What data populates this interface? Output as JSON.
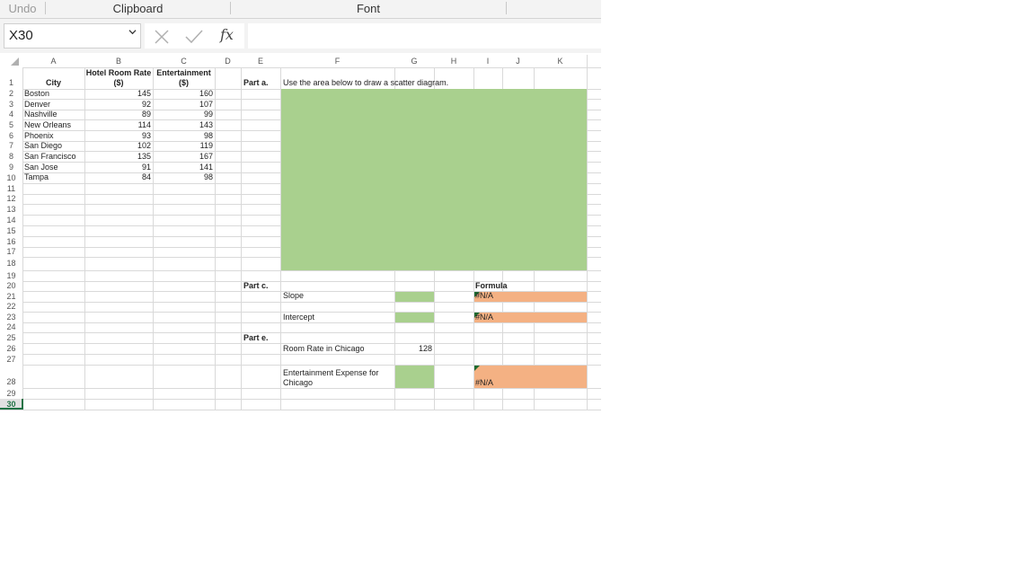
{
  "ribbon": {
    "undo": "Undo",
    "clipboard": "Clipboard",
    "font": "Font"
  },
  "formula_bar": {
    "name_box": "X30",
    "formula": ""
  },
  "columns": [
    "A",
    "B",
    "C",
    "D",
    "E",
    "F",
    "G",
    "H",
    "I",
    "J",
    "K"
  ],
  "rows": [
    "1",
    "2",
    "3",
    "4",
    "5",
    "6",
    "7",
    "8",
    "9",
    "10",
    "11",
    "12",
    "13",
    "14",
    "15",
    "16",
    "17",
    "18",
    "19",
    "20",
    "21",
    "22",
    "23",
    "24",
    "25",
    "26",
    "27",
    "28",
    "29",
    "30"
  ],
  "table": {
    "header_city": "City",
    "header_rate_1": "Hotel Room Rate",
    "header_rate_2": "($)",
    "header_ent_1": "Entertainment",
    "header_ent_2": "($)",
    "data": [
      {
        "city": "Boston",
        "rate": "145",
        "ent": "160"
      },
      {
        "city": "Denver",
        "rate": "92",
        "ent": "107"
      },
      {
        "city": "Nashville",
        "rate": "89",
        "ent": "99"
      },
      {
        "city": "New Orleans",
        "rate": "114",
        "ent": "143"
      },
      {
        "city": "Phoenix",
        "rate": "93",
        "ent": "98"
      },
      {
        "city": "San Diego",
        "rate": "102",
        "ent": "119"
      },
      {
        "city": "San Francisco",
        "rate": "135",
        "ent": "167"
      },
      {
        "city": "San Jose",
        "rate": "91",
        "ent": "141"
      },
      {
        "city": "Tampa",
        "rate": "84",
        "ent": "98"
      }
    ]
  },
  "parts": {
    "part_a": "Part a.",
    "part_a_text": "Use the area below to draw a scatter diagram.",
    "part_c": "Part c.",
    "formula_header": "Formula",
    "slope": "Slope",
    "intercept": "Intercept",
    "part_e": "Part e.",
    "room_rate_chicago": "Room Rate in Chicago",
    "room_rate_value": "128",
    "ent_expense_1": "Entertainment Expense for",
    "ent_expense_2": "Chicago",
    "na_slope": "#N/A",
    "na_intercept": "#N/A",
    "na_expense": "#N/A"
  },
  "colors": {
    "answer_green": "#a9d08e",
    "formula_orange": "#f4b183",
    "error_marker": "#1e6b30"
  }
}
